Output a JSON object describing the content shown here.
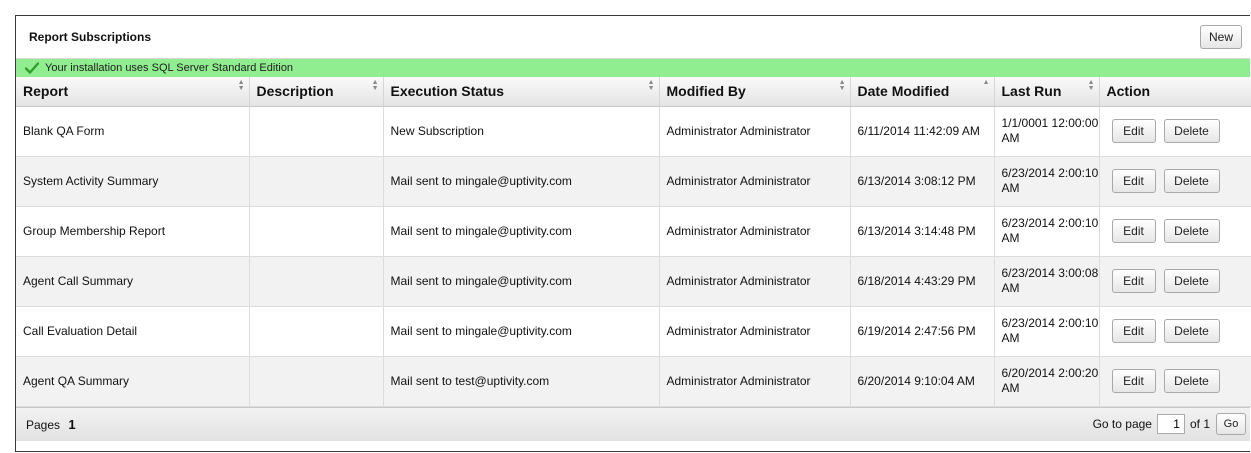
{
  "header": {
    "title": "Report Subscriptions",
    "new_label": "New"
  },
  "notice": {
    "text": "Your installation uses SQL Server Standard Edition",
    "color": "#90ee90"
  },
  "columns": [
    "Report",
    "Description",
    "Execution Status",
    "Modified By",
    "Date Modified",
    "Last Run",
    "Action"
  ],
  "rows": [
    {
      "report": "Blank QA Form",
      "description": "",
      "status": "New Subscription",
      "modified_by": "Administrator Administrator",
      "date_modified": "6/11/2014 11:42:09 AM",
      "last_run": "1/1/0001 12:00:00 AM"
    },
    {
      "report": "System Activity Summary",
      "description": "",
      "status": "Mail sent to mingale@uptivity.com",
      "modified_by": "Administrator Administrator",
      "date_modified": "6/13/2014 3:08:12 PM",
      "last_run": "6/23/2014 2:00:10 AM"
    },
    {
      "report": "Group Membership Report",
      "description": "",
      "status": "Mail sent to mingale@uptivity.com",
      "modified_by": "Administrator Administrator",
      "date_modified": "6/13/2014 3:14:48 PM",
      "last_run": "6/23/2014 2:00:10 AM"
    },
    {
      "report": "Agent Call Summary",
      "description": "",
      "status": "Mail sent to mingale@uptivity.com",
      "modified_by": "Administrator Administrator",
      "date_modified": "6/18/2014 4:43:29 PM",
      "last_run": "6/23/2014 3:00:08 AM"
    },
    {
      "report": "Call Evaluation Detail",
      "description": "",
      "status": "Mail sent to mingale@uptivity.com",
      "modified_by": "Administrator Administrator",
      "date_modified": "6/19/2014 2:47:56 PM",
      "last_run": "6/23/2014 2:00:10 AM"
    },
    {
      "report": "Agent QA Summary",
      "description": "",
      "status": "Mail sent to test@uptivity.com",
      "modified_by": "Administrator Administrator",
      "date_modified": "6/20/2014 9:10:04 AM",
      "last_run": "6/20/2014 2:00:20 AM"
    }
  ],
  "actions": {
    "edit_label": "Edit",
    "delete_label": "Delete"
  },
  "footer": {
    "pages_label": "Pages",
    "current_page": "1",
    "goto_label": "Go to page",
    "page_input_value": "1",
    "of_label": "of 1",
    "go_label": "Go"
  }
}
